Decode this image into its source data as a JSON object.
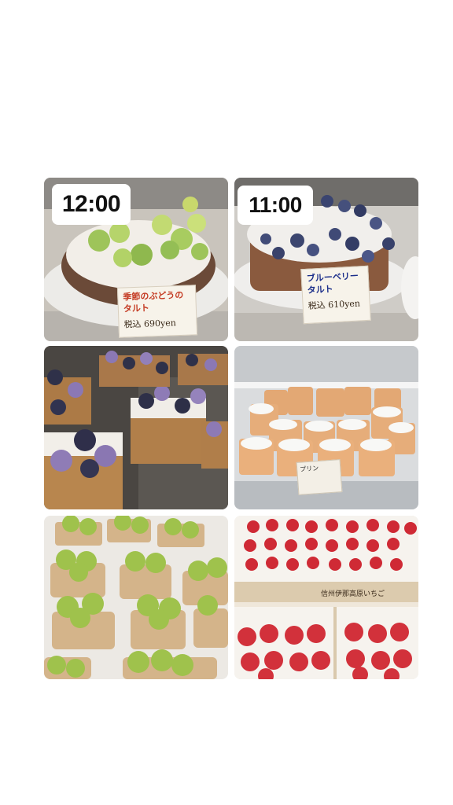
{
  "tiles": [
    {
      "id": "grape-tart-display",
      "time": "12:00",
      "card_name": "季節のぶどうのタルト",
      "card_price": "税込 690yen"
    },
    {
      "id": "blueberry-tart-display",
      "time": "11:00",
      "card_name": "ブルーベリー タルト",
      "card_price": "税込 610yen"
    },
    {
      "id": "purple-berry-tarts"
    },
    {
      "id": "pudding-cups-case",
      "card_name": "プリン"
    },
    {
      "id": "grape-pastries"
    },
    {
      "id": "strawberry-boxes",
      "box_label": "信州伊那高原いちご"
    }
  ],
  "colors": {
    "background": "#ffffff",
    "badge": "#ffffff",
    "badge_text": "#111111"
  }
}
